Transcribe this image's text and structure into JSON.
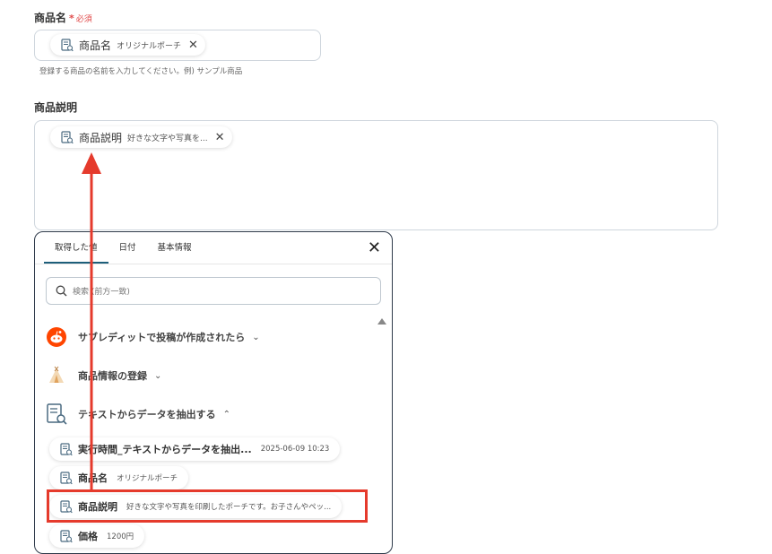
{
  "product_name": {
    "label": "商品名",
    "required_star": "*",
    "required_text": "必須",
    "chip_name": "商品名",
    "chip_value": "オリジナルポーチ",
    "help": "登録する商品の名前を入力してください。例) サンプル商品"
  },
  "product_desc": {
    "label": "商品説明",
    "chip_name": "商品説明",
    "chip_value": "好きな文字や写真を..."
  },
  "panel": {
    "tabs": [
      "取得した値",
      "日付",
      "基本情報"
    ],
    "search_placeholder": "検索 (前方一致)",
    "groups": [
      {
        "title": "サブレディットで投稿が作成されたら",
        "icon": "reddit-icon",
        "chevron": "down"
      },
      {
        "title": "商品情報の登録",
        "icon": "teepee-icon",
        "chevron": "down"
      },
      {
        "title": "テキストからデータを抽出する",
        "icon": "document-search-icon",
        "chevron": "up"
      }
    ],
    "items": [
      {
        "name": "実行時間_テキストからデータを抽出...",
        "value": "2025-06-09 10:23"
      },
      {
        "name": "商品名",
        "value": "オリジナルポーチ"
      },
      {
        "name": "商品説明",
        "value": "好きな文字や写真を印刷したポーチです。お子さんやペッ..."
      },
      {
        "name": "価格",
        "value": "1200円"
      }
    ]
  },
  "colors": {
    "required": "#e04848",
    "annotation": "#e53a2c",
    "tab_active": "#1d5f7a"
  }
}
